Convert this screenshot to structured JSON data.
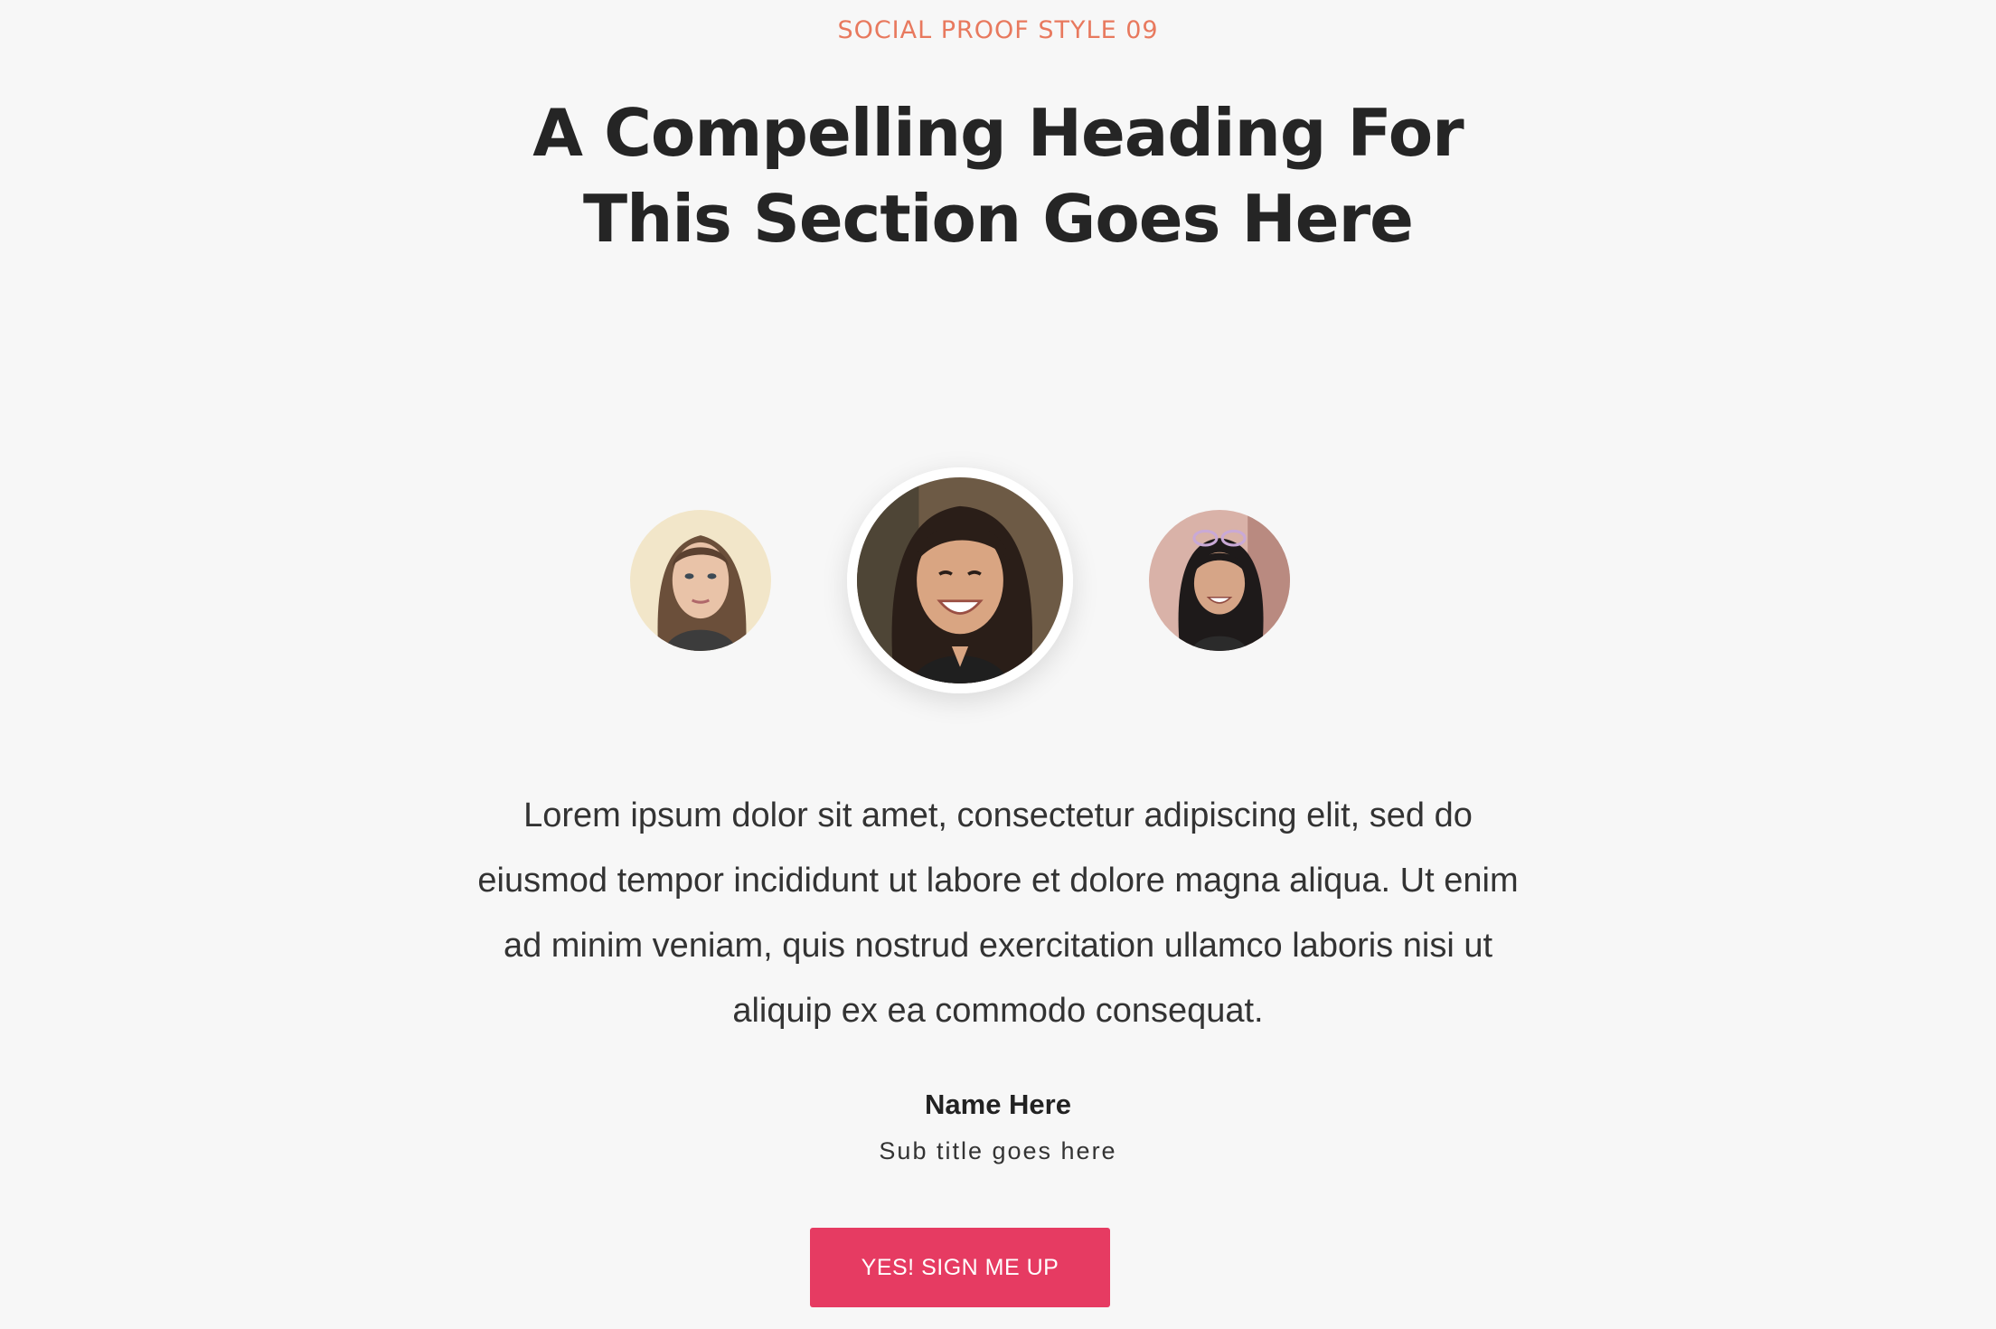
{
  "section": {
    "eyebrow": "SOCIAL PROOF STYLE 09",
    "heading_line1": "A Compelling Heading For",
    "heading_line2": "This Section Goes Here"
  },
  "testimonial": {
    "quote": "Lorem ipsum dolor sit amet, consectetur adipiscing elit, sed do eiusmod tempor incididunt ut labore et dolore magna aliqua. Ut enim ad minim veniam, quis nostrud exercitation ullamco laboris nisi ut aliquip ex ea commodo consequat.",
    "name": "Name Here",
    "subtitle": "Sub title goes here"
  },
  "cta": {
    "label": "YES! SIGN ME UP"
  },
  "colors": {
    "background": "#f7f7f7",
    "eyebrow": "#e8795e",
    "heading": "#252525",
    "button": "#e63b62",
    "button_text": "#ffffff"
  }
}
